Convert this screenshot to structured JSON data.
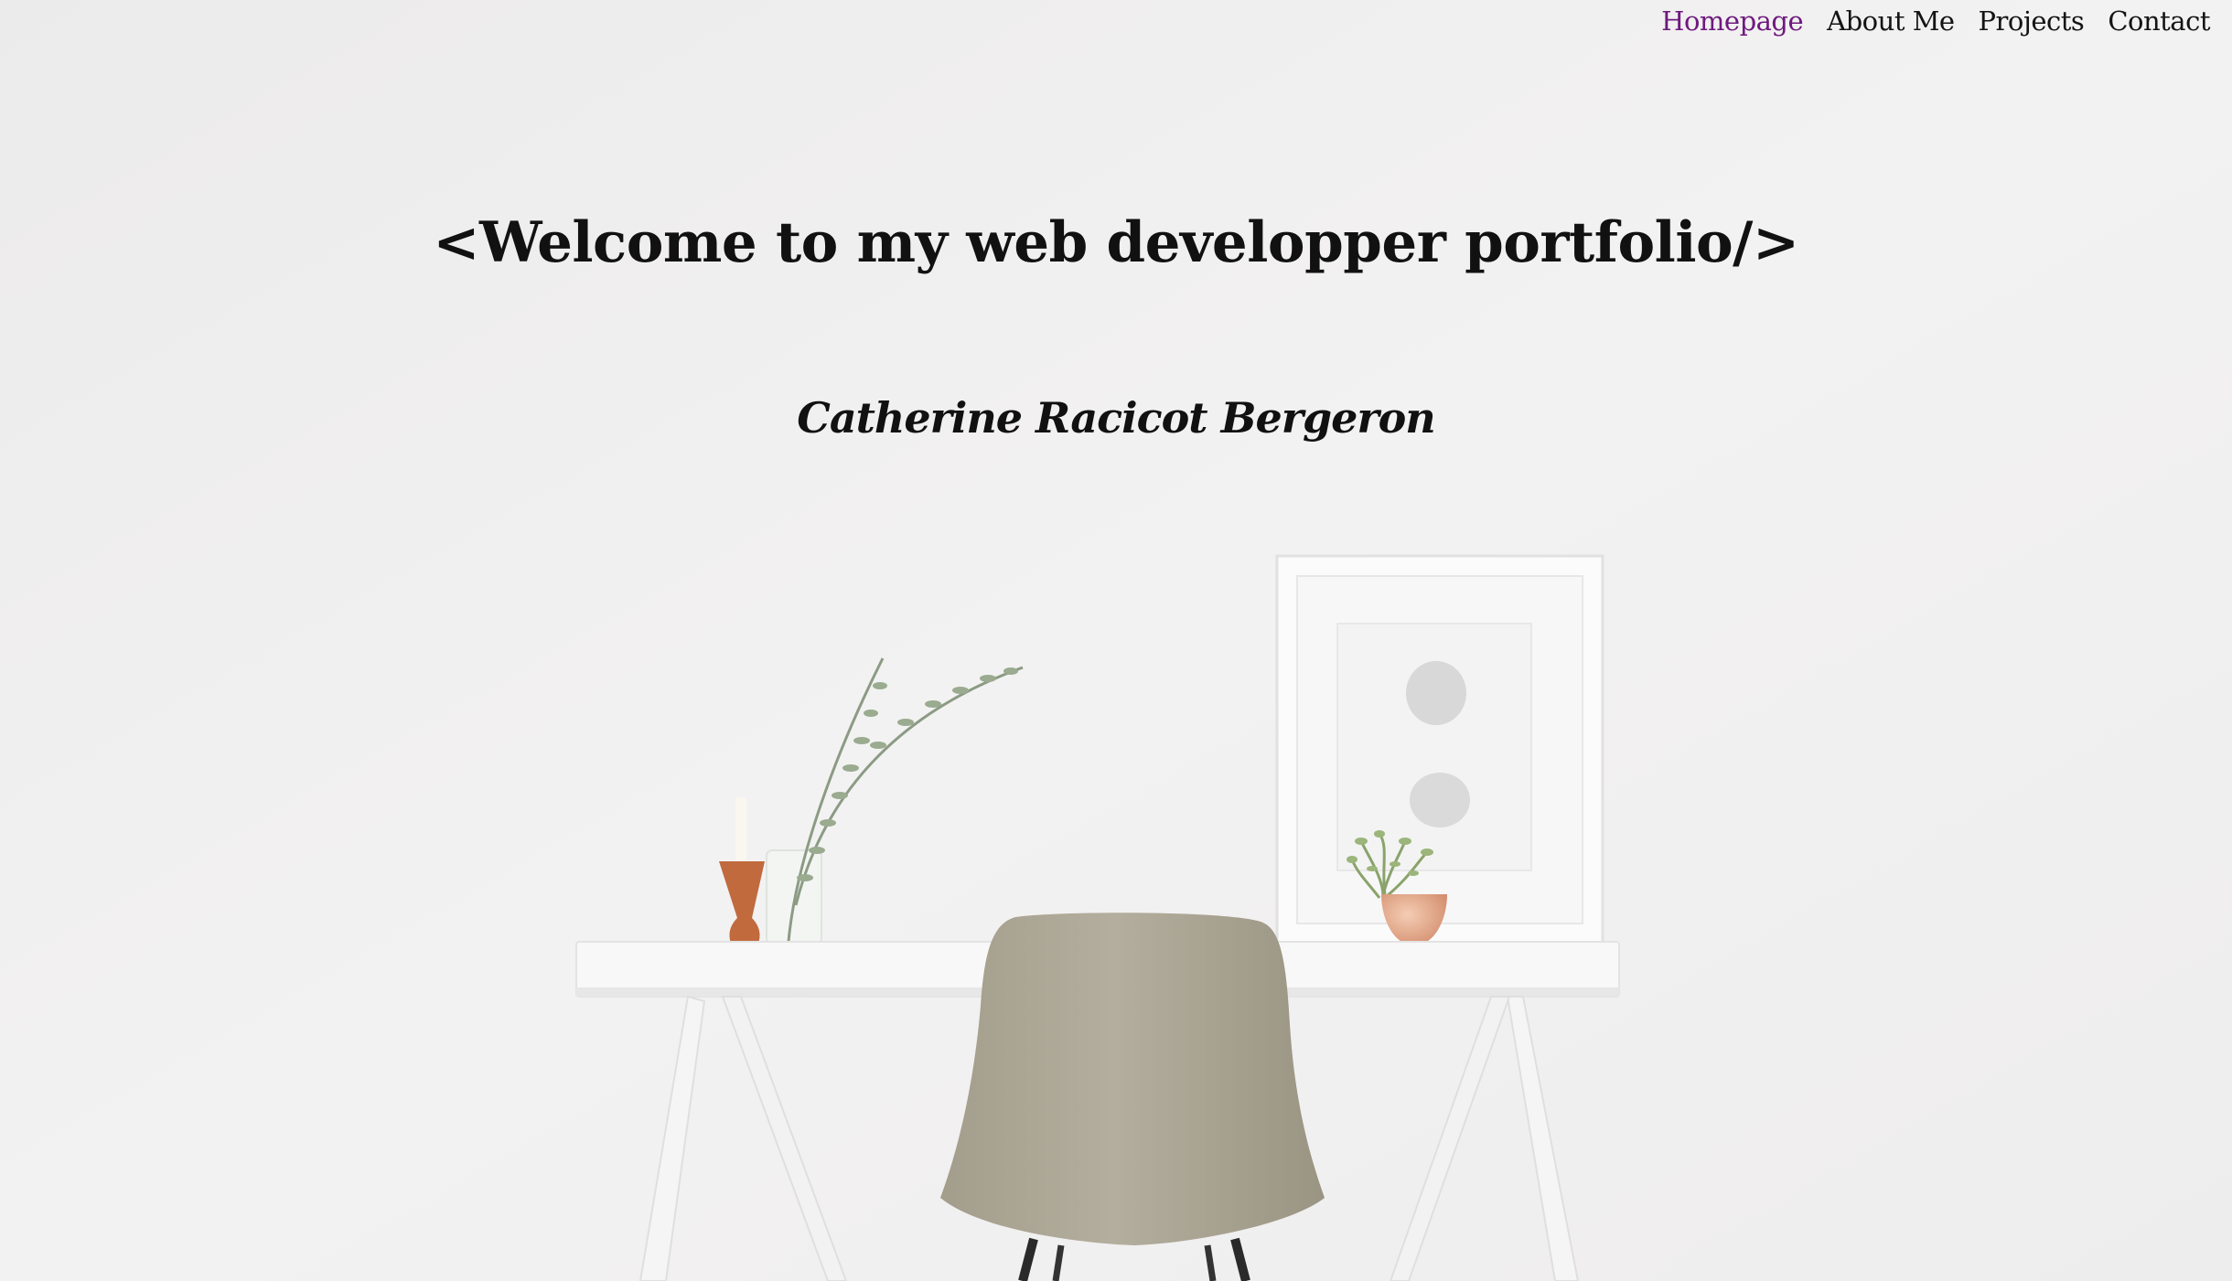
{
  "nav": {
    "items": [
      {
        "label": "Homepage",
        "active": true
      },
      {
        "label": "About Me",
        "active": false
      },
      {
        "label": "Projects",
        "active": false
      },
      {
        "label": "Contact",
        "active": false
      }
    ]
  },
  "hero": {
    "title": "<Welcome to my web developper portfolio/>",
    "name": "Catherine Racicot Bergeron"
  },
  "colors": {
    "background": "#efeeee",
    "text": "#141414",
    "nav_active": "#6e1a7f"
  }
}
